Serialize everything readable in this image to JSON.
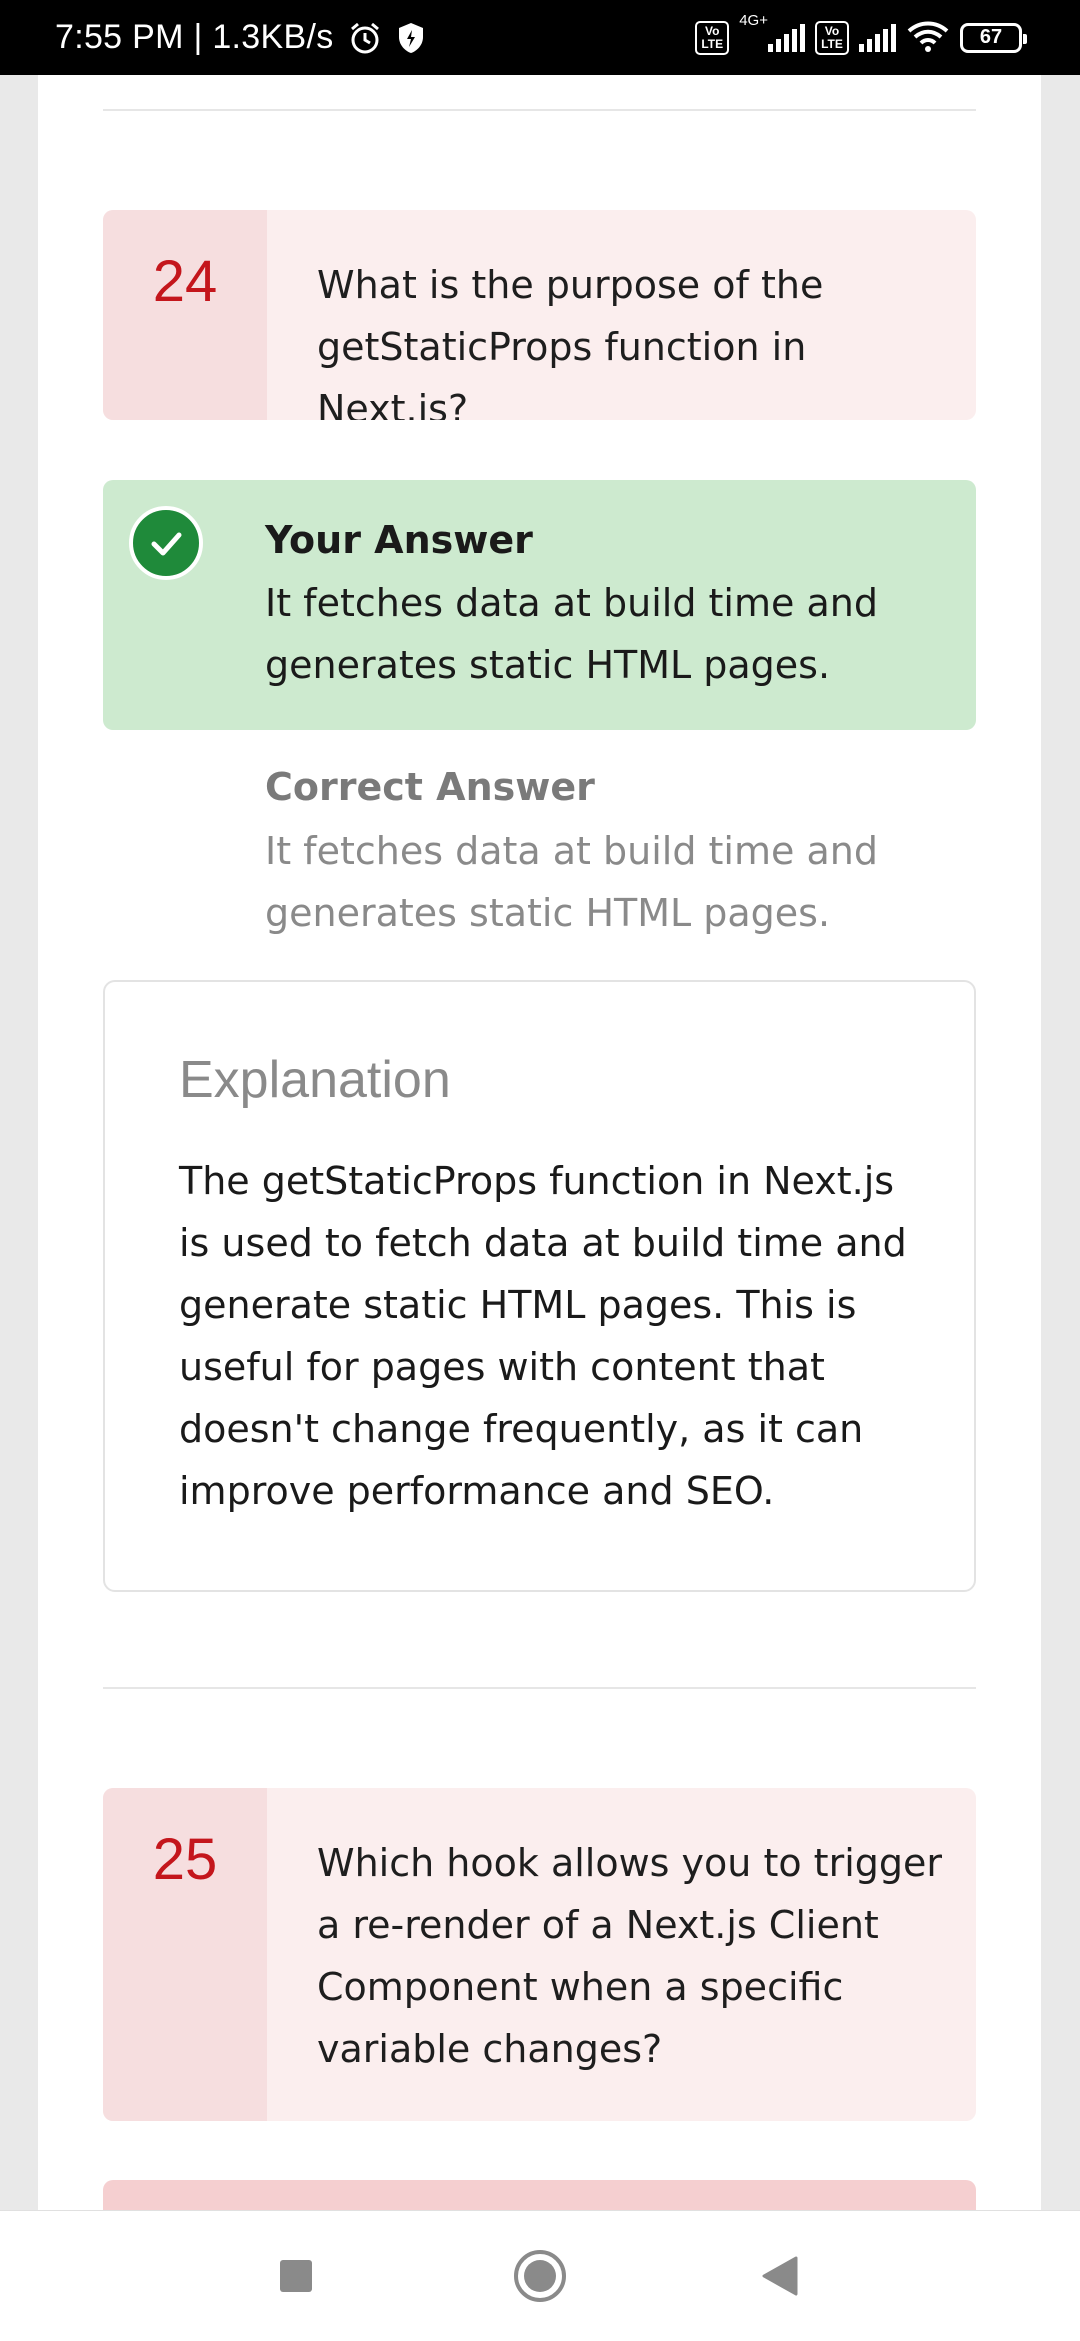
{
  "status_bar": {
    "time_speed": "7:55 PM | 1.3KB/s",
    "network": "4G+",
    "volte_label": "Vo\nLTE",
    "battery": "67",
    "icons": [
      "alarm-icon",
      "shield-icon",
      "volte-icon",
      "signal-icon",
      "wifi-icon",
      "battery-icon"
    ]
  },
  "question_24": {
    "number": "24",
    "text": "What is the purpose of the getStaticProps function in Next.js?"
  },
  "your_answer": {
    "label": "Your Answer",
    "text": "It fetches data at build time and generates static HTML pages."
  },
  "correct_answer": {
    "label": "Correct Answer",
    "text": "It fetches data at build time and generates static HTML pages."
  },
  "explanation": {
    "title": "Explanation",
    "body": "The getStaticProps function in Next.js is used to fetch data at build time and generate static HTML pages. This is useful for pages with content that doesn't change frequently, as it can improve performance and SEO."
  },
  "question_25": {
    "number": "25",
    "text": "Which hook allows you to trigger a re-render of a Next.js Client Component when a specific variable changes?"
  },
  "nav": {
    "buttons": [
      "recents-button",
      "home-button",
      "back-button"
    ]
  },
  "colors": {
    "question_number": "#c4161c",
    "question_bg": "#fbeeee",
    "question_num_bg": "#f6dedf",
    "answer_bg": "#cdeacf",
    "check": "#1f8a3a"
  }
}
